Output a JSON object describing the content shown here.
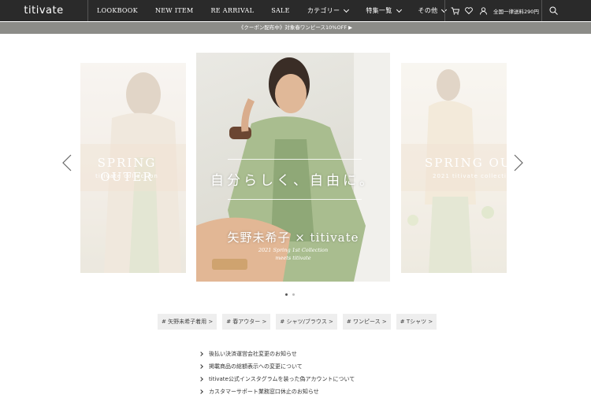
{
  "header": {
    "logo": "titivate",
    "nav": [
      {
        "label": "LOOKBOOK",
        "jp": false,
        "dropdown": false
      },
      {
        "label": "NEW ITEM",
        "jp": false,
        "dropdown": false
      },
      {
        "label": "RE ARRIVAL",
        "jp": false,
        "dropdown": false
      },
      {
        "label": "SALE",
        "jp": false,
        "dropdown": false
      },
      {
        "label": "カテゴリー",
        "jp": true,
        "dropdown": true
      },
      {
        "label": "特集一覧",
        "jp": true,
        "dropdown": true
      },
      {
        "label": "その他",
        "jp": true,
        "dropdown": true
      }
    ],
    "shipping": "全国一律送料290円",
    "icons": [
      "cart-icon",
      "heart-icon",
      "user-icon",
      "search-icon"
    ]
  },
  "banner": {
    "text": "《クーポン配布中》対象春ワンピース10%OFF ▶"
  },
  "carousel": {
    "left": {
      "title": "SPRING OUTER",
      "subtitle": "titivate collection"
    },
    "center": {
      "headline": "自分らしく、自由に。",
      "title": "矢野未希子 × titivate",
      "subtitle1": "2021 Spring 1st Collection",
      "subtitle2": "meets titivate"
    },
    "right": {
      "title": "SPRING OUTER",
      "subtitle": "2021 titivate collection"
    },
    "dots": 2,
    "active_dot": 0
  },
  "tags": [
    "# 矢野未希子着用 >",
    "# 春アウター >",
    "# シャツ/ブラウス >",
    "# ワンピース >",
    "# Tシャツ >"
  ],
  "news": [
    "後払い決済運営会社変更のお知らせ",
    "掲載商品の総額表示への変更について",
    "titivate公式インスタグラムを装った偽アカウントについて",
    "カスタマーサポート業務窓口休止のお知らせ"
  ],
  "colors": {
    "header_bg": "#2a2a2a",
    "banner_bg": "#8c8c88",
    "tag_bg": "#eeeeee"
  }
}
